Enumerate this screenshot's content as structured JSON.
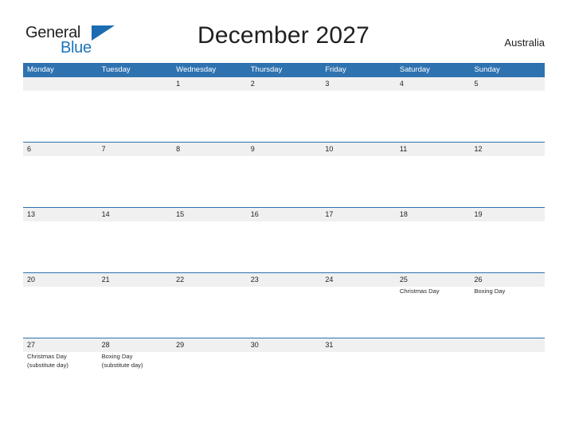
{
  "brand": {
    "name_part1": "General",
    "name_part2": "Blue",
    "flag_icon": "blue-flag-triangle"
  },
  "header": {
    "title": "December 2027",
    "region": "Australia"
  },
  "calendar": {
    "weekdays": [
      "Monday",
      "Tuesday",
      "Wednesday",
      "Thursday",
      "Friday",
      "Saturday",
      "Sunday"
    ],
    "accent_color": "#2f72b0",
    "date_band_color": "#f0f0f0",
    "weeks": [
      {
        "days": [
          {
            "date": "",
            "events": ""
          },
          {
            "date": "",
            "events": ""
          },
          {
            "date": "1",
            "events": ""
          },
          {
            "date": "2",
            "events": ""
          },
          {
            "date": "3",
            "events": ""
          },
          {
            "date": "4",
            "events": ""
          },
          {
            "date": "5",
            "events": ""
          }
        ]
      },
      {
        "days": [
          {
            "date": "6",
            "events": ""
          },
          {
            "date": "7",
            "events": ""
          },
          {
            "date": "8",
            "events": ""
          },
          {
            "date": "9",
            "events": ""
          },
          {
            "date": "10",
            "events": ""
          },
          {
            "date": "11",
            "events": ""
          },
          {
            "date": "12",
            "events": ""
          }
        ]
      },
      {
        "days": [
          {
            "date": "13",
            "events": ""
          },
          {
            "date": "14",
            "events": ""
          },
          {
            "date": "15",
            "events": ""
          },
          {
            "date": "16",
            "events": ""
          },
          {
            "date": "17",
            "events": ""
          },
          {
            "date": "18",
            "events": ""
          },
          {
            "date": "19",
            "events": ""
          }
        ]
      },
      {
        "days": [
          {
            "date": "20",
            "events": ""
          },
          {
            "date": "21",
            "events": ""
          },
          {
            "date": "22",
            "events": ""
          },
          {
            "date": "23",
            "events": ""
          },
          {
            "date": "24",
            "events": ""
          },
          {
            "date": "25",
            "events": "Christmas Day"
          },
          {
            "date": "26",
            "events": "Boxing Day"
          }
        ]
      },
      {
        "days": [
          {
            "date": "27",
            "events": "Christmas Day\n(substitute day)"
          },
          {
            "date": "28",
            "events": "Boxing Day\n(substitute day)"
          },
          {
            "date": "29",
            "events": ""
          },
          {
            "date": "30",
            "events": ""
          },
          {
            "date": "31",
            "events": ""
          },
          {
            "date": "",
            "events": ""
          },
          {
            "date": "",
            "events": ""
          }
        ]
      }
    ]
  }
}
